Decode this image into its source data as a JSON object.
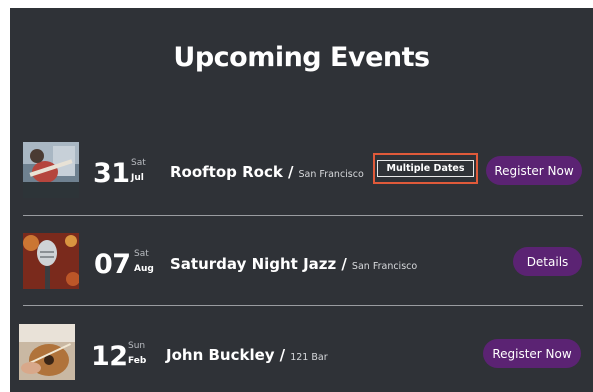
{
  "page": {
    "title": "Upcoming Events"
  },
  "events": [
    {
      "day": "31",
      "weekday": "Sat",
      "month": "Jul",
      "name": "Rooftop Rock",
      "separator": "/",
      "venue": "San Francisco",
      "multiple_dates_label": "Multiple Dates",
      "action_label": "Register Now",
      "thumbnail": "guitarist-photo"
    },
    {
      "day": "07",
      "weekday": "Sat",
      "month": "Aug",
      "name": "Saturday Night Jazz",
      "separator": "/",
      "venue": "San Francisco",
      "action_label": "Details",
      "thumbnail": "microphone-photo"
    },
    {
      "day": "12",
      "weekday": "Sun",
      "month": "Feb",
      "name": "John Buckley",
      "separator": "/",
      "venue": "121 Bar",
      "action_label": "Register Now",
      "thumbnail": "acoustic-guitar-photo"
    }
  ],
  "colors": {
    "background": "#2f3237",
    "button": "#5b2373",
    "highlight_border": "#e05a3a",
    "divider": "#9a9ca0"
  }
}
